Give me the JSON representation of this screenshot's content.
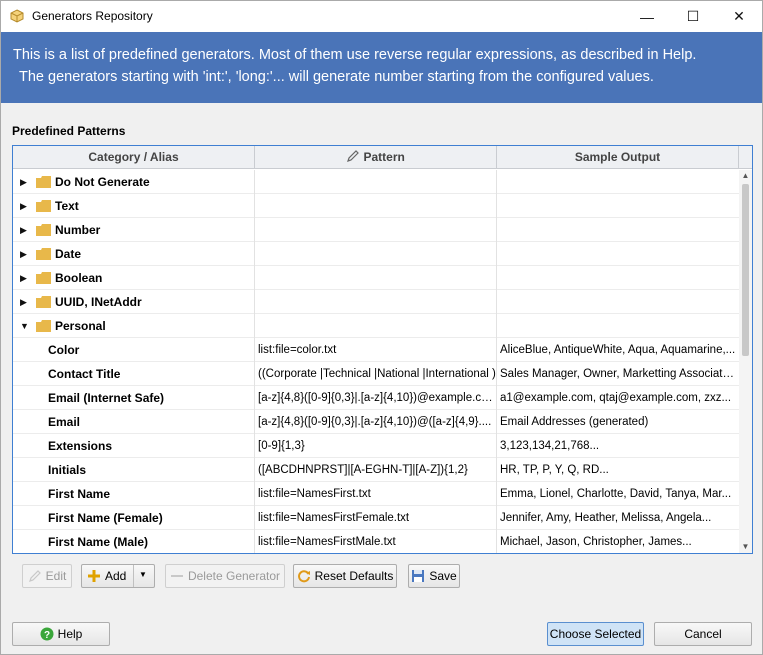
{
  "window": {
    "title": "Generators Repository",
    "minimize_glyph": "—",
    "maximize_glyph": "☐",
    "close_glyph": "✕"
  },
  "banner": {
    "line1": "This is a list of predefined generators. Most of them use reverse regular expressions, as described in Help.",
    "line2": "The generators starting with 'int:', 'long:'... will generate number starting from the configured values."
  },
  "section": {
    "label": "Predefined Patterns"
  },
  "table": {
    "headers": {
      "category": "Category / Alias",
      "pattern": "Pattern",
      "sample": "Sample Output"
    },
    "categories": [
      {
        "label": "Do Not Generate",
        "expanded": false
      },
      {
        "label": "Text",
        "expanded": false
      },
      {
        "label": "Number",
        "expanded": false
      },
      {
        "label": "Date",
        "expanded": false
      },
      {
        "label": "Boolean",
        "expanded": false
      },
      {
        "label": "UUID, INetAddr",
        "expanded": false
      },
      {
        "label": "Personal",
        "expanded": true
      }
    ],
    "rows": [
      {
        "alias": "Color",
        "pattern": "list:file=color.txt",
        "sample": "AliceBlue, AntiqueWhite, Aqua, Aquamarine,..."
      },
      {
        "alias": "Contact Title",
        "pattern": "((Corporate |Technical |National |International )",
        "sample": "Sales Manager, Owner, Marketting Associate,..."
      },
      {
        "alias": "Email (Internet Safe)",
        "pattern": "[a-z]{4,8}([0-9]{0,3}|.[a-z]{4,10})@example.com",
        "sample": "a1@example.com, qtaj@example.com, zxz..."
      },
      {
        "alias": "Email",
        "pattern": "[a-z]{4,8}([0-9]{0,3}|.[a-z]{4,10})@([a-z]{4,9}....",
        "sample": "Email Addresses (generated)"
      },
      {
        "alias": "Extensions",
        "pattern": "[0-9]{1,3}",
        "sample": "3,123,134,21,768..."
      },
      {
        "alias": "Initials",
        "pattern": "([ABCDHNPRST]|[A-EGHN-T]|[A-Z]){1,2}",
        "sample": "HR, TP, P, Y, Q, RD..."
      },
      {
        "alias": "First Name",
        "pattern": "list:file=NamesFirst.txt",
        "sample": "Emma, Lionel, Charlotte, David, Tanya, Mar..."
      },
      {
        "alias": "First Name (Female)",
        "pattern": "list:file=NamesFirstFemale.txt",
        "sample": "Jennifer, Amy, Heather, Melissa, Angela..."
      },
      {
        "alias": "First Name (Male)",
        "pattern": "list:file=NamesFirstMale.txt",
        "sample": "Michael, Jason, Christopher, James..."
      }
    ]
  },
  "toolbar": {
    "edit_label": "Edit",
    "add_label": "Add",
    "delete_label": "Delete Generator",
    "reset_label": "Reset Defaults",
    "save_label": "Save"
  },
  "footer": {
    "help_label": "Help",
    "choose_label": "Choose Selected",
    "cancel_label": "Cancel"
  },
  "colors": {
    "banner": "#4a74b8",
    "folder": "#e8b84a",
    "table_border": "#3f7fd2"
  },
  "icons": [
    "app-icon",
    "folder-icon",
    "pencil-icon",
    "plus-icon",
    "refresh-icon",
    "save-icon",
    "help-icon"
  ]
}
